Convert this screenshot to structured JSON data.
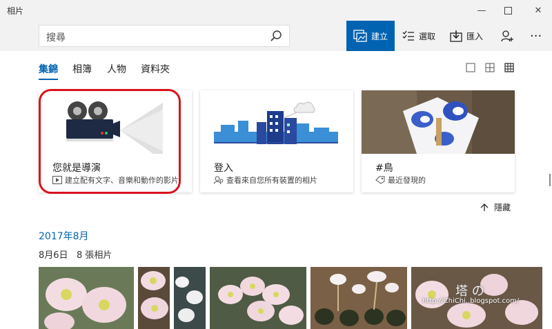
{
  "window": {
    "title": "相片"
  },
  "search": {
    "placeholder": "搜尋"
  },
  "toolbar": {
    "create_label": "建立",
    "select_label": "選取",
    "import_label": "匯入"
  },
  "nav": {
    "tabs": [
      {
        "label": "集錦",
        "active": true
      },
      {
        "label": "相簿"
      },
      {
        "label": "人物"
      },
      {
        "label": "資料夾"
      }
    ]
  },
  "cards": [
    {
      "title": "您就是導演",
      "subtitle": "建立配有文字、音樂和動作的影片"
    },
    {
      "title": "登入",
      "subtitle": "查看來自您所有裝置的相片"
    },
    {
      "title": "#鳥",
      "subtitle": "最近發現的"
    }
  ],
  "hide_label": "隱藏",
  "timeline": {
    "month": "2017年8月",
    "day": "8月6日",
    "count": "8 張相片"
  },
  "watermark": {
    "chars": "塔 の",
    "url": "http://ChiChi..blogspot.com/"
  },
  "colors": {
    "accent": "#0063b1",
    "highlight": "#d9121c"
  }
}
